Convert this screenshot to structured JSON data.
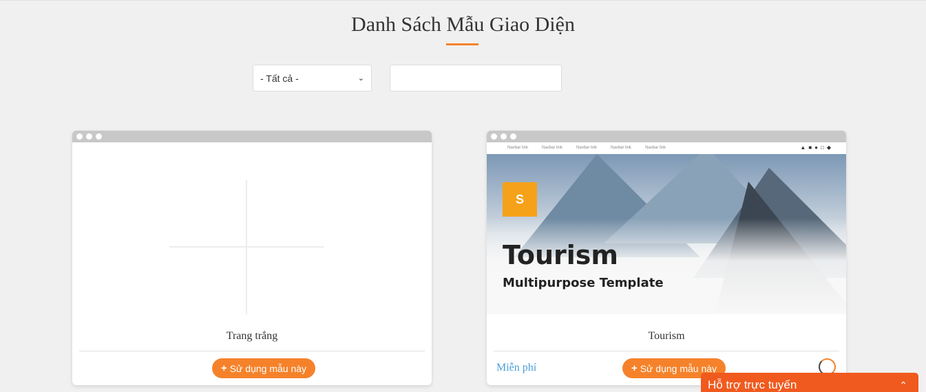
{
  "header": {
    "title": "Danh Sách Mẫu Giao Diện"
  },
  "filter": {
    "selected": "- Tất cả -",
    "search_value": ""
  },
  "templates": [
    {
      "name": "Trang trắng",
      "button_label": "Sử dụng mẫu này"
    },
    {
      "name": "Tourism",
      "price": "Miễn phí",
      "button_label": "Sử dụng mẫu này",
      "preview": {
        "nav_links": [
          "Navbar link",
          "Navbar link",
          "Navbar link",
          "Navbar link",
          "Navbar link"
        ],
        "logo": "S",
        "title": "Tourism",
        "subtitle": "Multipurpose Template"
      }
    }
  ],
  "support": {
    "label": "Hỗ trợ trực tuyến"
  },
  "colors": {
    "accent": "#f5822a",
    "support": "#f05a1e",
    "price": "#4a9fd8"
  }
}
